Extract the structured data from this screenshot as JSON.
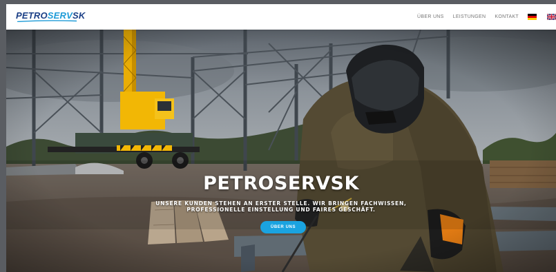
{
  "logo": {
    "part1": "PETRO",
    "part2": "SERV",
    "part3": "SK"
  },
  "nav": {
    "links": [
      "ÜBER UNS",
      "LEISTUNGEN",
      "KONTAKT"
    ],
    "flags": [
      "german-flag-icon",
      "uk-flag-icon"
    ]
  },
  "hero": {
    "title": "PETROSERVSK",
    "subtitle_line1": "UNSERE KUNDEN STEHEN AN ERSTER STELLE. WIR BRINGEN FACHWISSEN,",
    "subtitle_line2": "PROFESSIONELLE EINSTELLUNG UND FAIRES GESCHÄFT.",
    "button_label": "ÜBER UNS"
  },
  "colors": {
    "brand_dark": "#1b3f86",
    "brand_light": "#1e9bd7",
    "button": "#1aa3e0",
    "crane": "#f2b705"
  }
}
